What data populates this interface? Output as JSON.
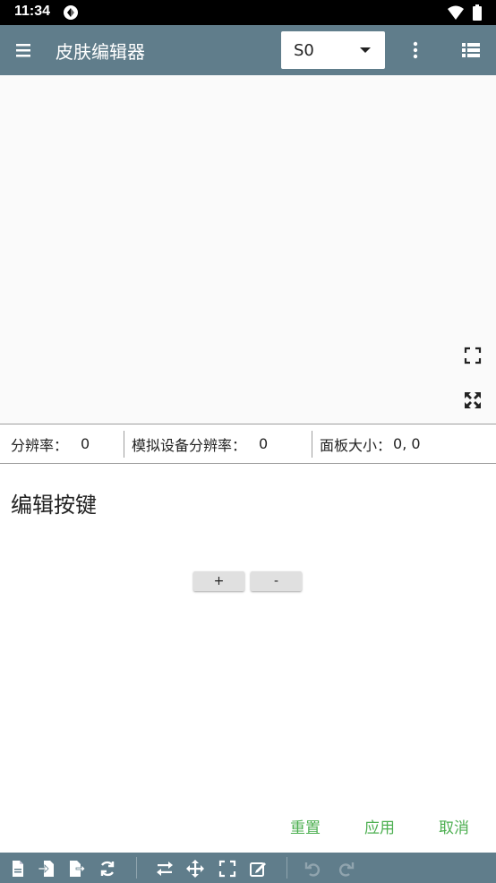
{
  "status_bar": {
    "time": "11:34"
  },
  "app_bar": {
    "title": "皮肤编辑器",
    "skin_selected": "S0"
  },
  "info_bar": {
    "resolution_label": "分辨率：",
    "resolution_value": "0",
    "sim_resolution_label": "模拟设备分辨率：",
    "sim_resolution_value": "0",
    "panel_size_label": "面板大小：",
    "panel_size_value": "0, 0"
  },
  "editor": {
    "title": "编辑按键",
    "plus_label": "+",
    "minus_label": "-"
  },
  "actions": {
    "reset": "重置",
    "apply": "应用",
    "cancel": "取消"
  },
  "colors": {
    "app_bar": "#607d8b",
    "accent_green": "#4caf50",
    "preview_bg": "#fafafa"
  },
  "icons": {
    "toolbar": [
      "file-icon",
      "import-icon",
      "export-icon",
      "refresh-icon",
      "swap-icon",
      "move-icon",
      "fullscreen-icon",
      "edit-icon",
      "undo-icon",
      "redo-icon"
    ]
  }
}
